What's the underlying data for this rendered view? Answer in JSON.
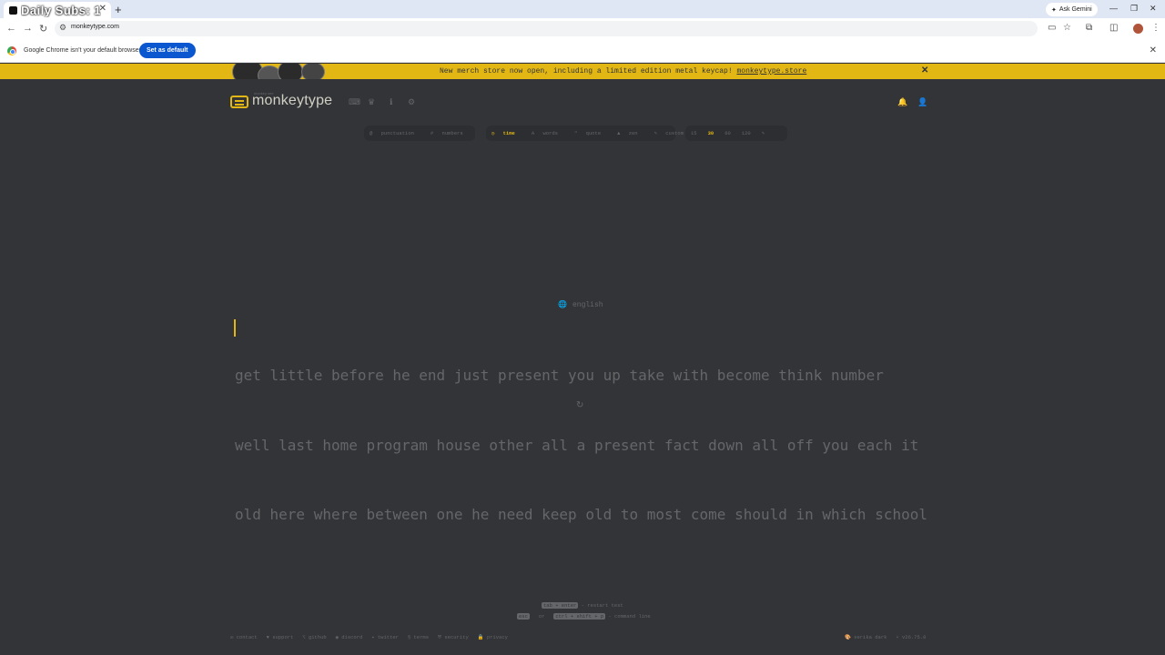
{
  "browser": {
    "tab_title": "Daily Subs: 1",
    "new_tab": "+",
    "ask_gemini": "Ask Gemini",
    "url": "monkeytype.com",
    "infobar_text": "Google Chrome isn't your default browser",
    "set_default": "Set as default"
  },
  "banner": {
    "text": "New merch store now open, including a limited edition metal keycap!",
    "link": "monkeytype.store",
    "close": "✕"
  },
  "header": {
    "logo_small": "monkey see",
    "logo": "monkeytype"
  },
  "config": {
    "modifiers": [
      "punctuation",
      "numbers"
    ],
    "modes": [
      "time",
      "words",
      "quote",
      "zen",
      "custom"
    ],
    "active_mode": "time",
    "durations": [
      "15",
      "30",
      "60",
      "120"
    ],
    "active_duration": "30"
  },
  "test": {
    "language": "english",
    "lines": [
      "get little before he end just present you up take with become think number",
      "well last home program house other all a present fact down all off you each it",
      "old here where between one he need keep old to most come should in which school"
    ]
  },
  "hints": {
    "restart_key": "tab + enter",
    "restart_label": "- restart test",
    "cmd_key1": "esc",
    "cmd_or": "or",
    "cmd_key2": "ctrl + shift + p",
    "cmd_label": "- command line"
  },
  "footer": {
    "links": [
      "contact",
      "support",
      "github",
      "discord",
      "twitter",
      "terms",
      "security",
      "privacy"
    ],
    "theme": "serika dark",
    "version": "v26.75.0"
  },
  "colors": {
    "background": "#323437",
    "main": "#e2b714",
    "sub": "#646669",
    "text": "#d1d0c5"
  }
}
